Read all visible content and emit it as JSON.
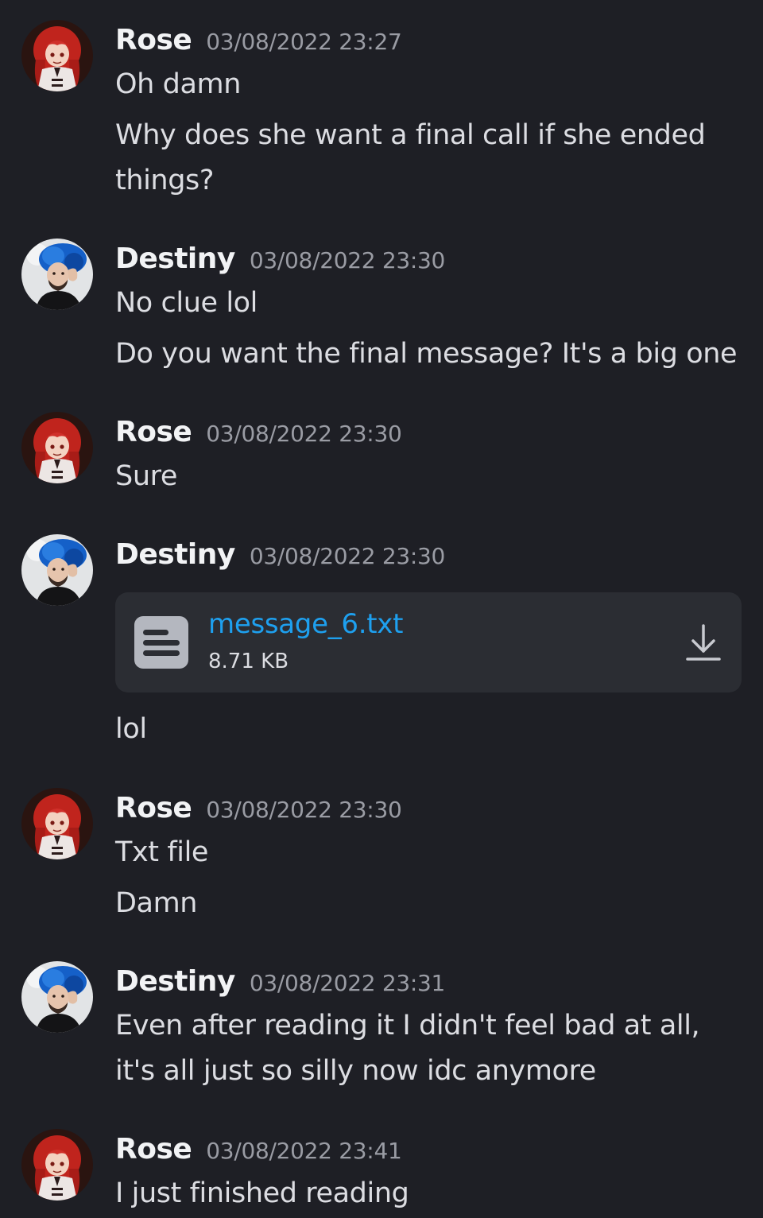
{
  "messages": [
    {
      "author": "Rose",
      "avatar": "rose-avatar",
      "timestamp": "03/08/2022 23:27",
      "lines": [
        "Oh damn",
        "Why does she want a final call if she ended things?"
      ]
    },
    {
      "author": "Destiny",
      "avatar": "destiny-avatar",
      "timestamp": "03/08/2022 23:30",
      "lines": [
        "No clue lol",
        "Do you want the final message? It's a big one"
      ]
    },
    {
      "author": "Rose",
      "avatar": "rose-avatar",
      "timestamp": "03/08/2022 23:30",
      "lines": [
        "Sure"
      ]
    },
    {
      "author": "Destiny",
      "avatar": "destiny-avatar",
      "timestamp": "03/08/2022 23:30",
      "attachment": {
        "file_name": "message_6.txt",
        "file_size": "8.71 KB",
        "icon": "text-file-icon",
        "action_icon": "download-icon"
      },
      "lines": [
        "lol"
      ]
    },
    {
      "author": "Rose",
      "avatar": "rose-avatar",
      "timestamp": "03/08/2022 23:30",
      "lines": [
        "Txt file",
        "Damn"
      ]
    },
    {
      "author": "Destiny",
      "avatar": "destiny-avatar",
      "timestamp": "03/08/2022 23:31",
      "lines": [
        "Even after reading it I didn't feel bad at all, it's all just so silly now idc anymore"
      ]
    },
    {
      "author": "Rose",
      "avatar": "rose-avatar",
      "timestamp": "03/08/2022 23:41",
      "lines": [
        "I just finished reading"
      ]
    }
  ],
  "colors": {
    "background": "#1e1f25",
    "attachment_bg": "#2b2d33",
    "link": "#1ea0ef",
    "author": "#f2f3f5",
    "timestamp": "#9a9ca4",
    "text": "#dcdde2"
  }
}
